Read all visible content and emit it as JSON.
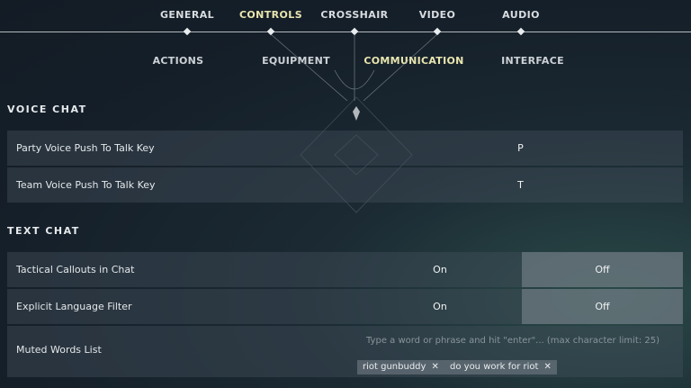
{
  "tabs": [
    {
      "label": "GENERAL",
      "active": false
    },
    {
      "label": "CONTROLS",
      "active": true
    },
    {
      "label": "CROSSHAIR",
      "active": false
    },
    {
      "label": "VIDEO",
      "active": false
    },
    {
      "label": "AUDIO",
      "active": false
    }
  ],
  "subtabs": [
    {
      "label": "ACTIONS",
      "active": false
    },
    {
      "label": "EQUIPMENT",
      "active": false
    },
    {
      "label": "COMMUNICATION",
      "active": true
    },
    {
      "label": "INTERFACE",
      "active": false
    }
  ],
  "voice_chat": {
    "title": "VOICE CHAT",
    "rows": [
      {
        "label": "Party Voice Push To Talk Key",
        "value": "P"
      },
      {
        "label": "Team Voice Push To Talk Key",
        "value": "T"
      }
    ]
  },
  "text_chat": {
    "title": "TEXT CHAT",
    "rows": [
      {
        "label": "Tactical Callouts in Chat",
        "on": "On",
        "off": "Off",
        "selected": "Off"
      },
      {
        "label": "Explicit Language Filter",
        "on": "On",
        "off": "Off",
        "selected": "Off"
      }
    ],
    "muted": {
      "label": "Muted Words List",
      "placeholder": "Type a word or phrase and hit \"enter\"... (max character limit: 25)",
      "tags": [
        "riot gunbuddy",
        "do you work for riot"
      ]
    }
  },
  "colors": {
    "accent": "#e9e6b0",
    "background": "#151f29",
    "row": "#3a4550",
    "selected": "#7a848c"
  },
  "icons": {
    "remove_tag": "close-icon",
    "tab_marker": "diamond-icon"
  }
}
